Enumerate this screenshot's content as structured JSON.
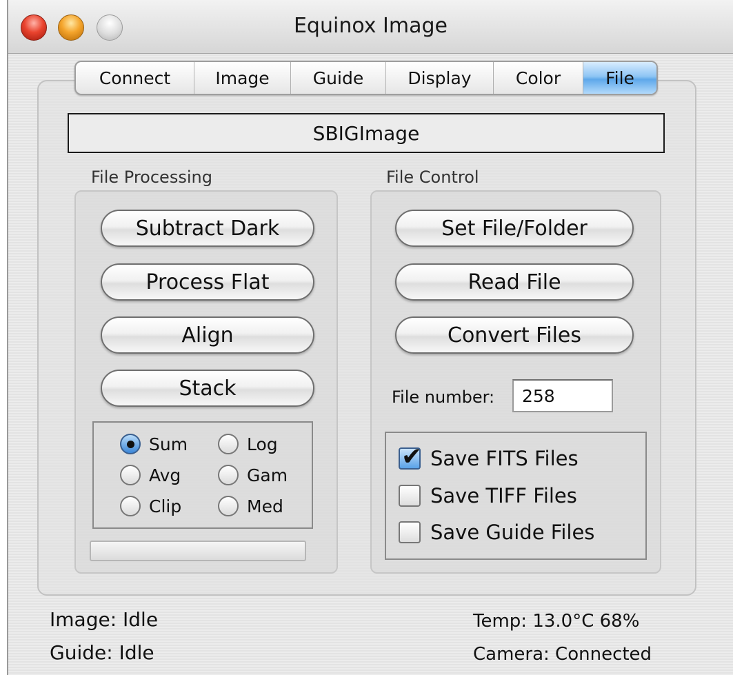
{
  "window": {
    "title": "Equinox Image"
  },
  "tabs": [
    {
      "label": "Connect",
      "active": false
    },
    {
      "label": "Image",
      "active": false
    },
    {
      "label": "Guide",
      "active": false
    },
    {
      "label": "Display",
      "active": false
    },
    {
      "label": "Color",
      "active": false
    },
    {
      "label": "File",
      "active": true
    }
  ],
  "name_field": {
    "value": "SBIGImage"
  },
  "file_processing": {
    "label": "File Processing",
    "buttons": [
      "Subtract Dark",
      "Process Flat",
      "Align",
      "Stack"
    ],
    "stack_modes": [
      {
        "label": "Sum",
        "selected": true
      },
      {
        "label": "Log",
        "selected": false
      },
      {
        "label": "Avg",
        "selected": false
      },
      {
        "label": "Gam",
        "selected": false
      },
      {
        "label": "Clip",
        "selected": false
      },
      {
        "label": "Med",
        "selected": false
      }
    ],
    "progress": 0
  },
  "file_control": {
    "label": "File Control",
    "buttons": [
      "Set File/Folder",
      "Read  File",
      "Convert Files"
    ],
    "file_number_label": "File number:",
    "file_number_value": "258",
    "options": [
      {
        "label": "Save FITS Files",
        "checked": true
      },
      {
        "label": "Save TIFF Files",
        "checked": false
      },
      {
        "label": "Save Guide Files",
        "checked": false
      }
    ]
  },
  "status": {
    "image": "Image: Idle",
    "guide": "Guide: Idle",
    "temp": "Temp: 13.0°C 68%",
    "camera": "Camera: Connected"
  },
  "colors": {
    "selected_tab": "#6aaeea",
    "checkbox_checked": "#5aa2e8"
  }
}
